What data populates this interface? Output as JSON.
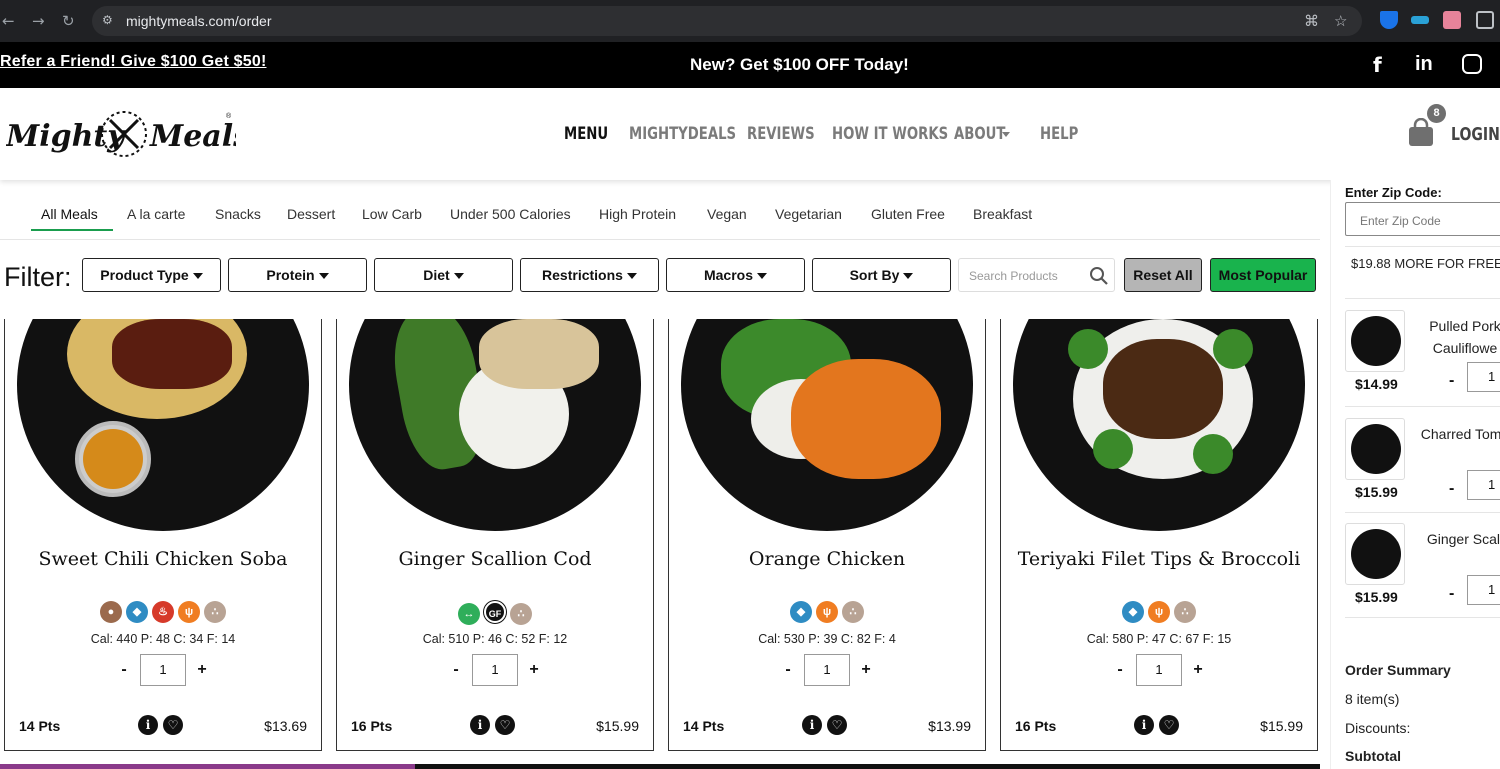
{
  "browser": {
    "url": "mightymeals.com/order"
  },
  "promo": {
    "referral": "Refer a Friend! Give $100 Get $50!",
    "headline": "New? Get $100 OFF Today!"
  },
  "header": {
    "logo_text": "Mighty Meals",
    "nav": [
      "MENU",
      "MIGHTYDEALS",
      "REVIEWS",
      "HOW IT WORKS",
      "ABOUT",
      "HELP"
    ],
    "cart_count": "8",
    "login": "LOGIN"
  },
  "tabs": [
    "All Meals",
    "A la carte",
    "Snacks",
    "Dessert",
    "Low Carb",
    "Under 500 Calories",
    "High Protein",
    "Vegan",
    "Vegetarian",
    "Gluten Free",
    "Breakfast"
  ],
  "filter": {
    "label": "Filter:",
    "buttons": [
      "Product Type",
      "Protein",
      "Diet",
      "Restrictions",
      "Macros",
      "Sort By"
    ],
    "search_placeholder": "Search Products",
    "reset": "Reset All",
    "popular": "Most Popular"
  },
  "products": [
    {
      "name": "Sweet Chili Chicken Soba",
      "macros": "Cal: 440  P: 48  C: 34  F: 14",
      "qty": "1",
      "pts": "14 Pts",
      "price": "$13.69"
    },
    {
      "name": "Ginger Scallion Cod",
      "macros": "Cal: 510  P: 46  C: 52  F: 12",
      "qty": "1",
      "pts": "16 Pts",
      "price": "$15.99"
    },
    {
      "name": "Orange Chicken",
      "macros": "Cal: 530  P: 39  C: 82  F: 4",
      "qty": "1",
      "pts": "14 Pts",
      "price": "$13.99"
    },
    {
      "name": "Teriyaki Filet Tips & Broccoli",
      "macros": "Cal: 580  P: 47  C: 67  F: 15",
      "qty": "1",
      "pts": "16 Pts",
      "price": "$15.99"
    }
  ],
  "sidebar": {
    "zip_label": "Enter Zip Code:",
    "zip_placeholder": "Enter Zip Code",
    "free_shipping": "$19.88 MORE FOR FREE",
    "items": [
      {
        "name": "Pulled Pork Cauliflowe",
        "price": "$14.99",
        "qty": "1"
      },
      {
        "name": "Charred Toma",
        "price": "$15.99",
        "qty": "1"
      },
      {
        "name": "Ginger Scall",
        "price": "$15.99",
        "qty": "1"
      }
    ],
    "summary_title": "Order Summary",
    "items_count": "8 item(s)",
    "discounts": "Discounts:",
    "subtotal": "Subtotal"
  },
  "colors": {
    "green": "#19b34d",
    "gray_button": "#b5b5b5",
    "black": "#000000"
  }
}
